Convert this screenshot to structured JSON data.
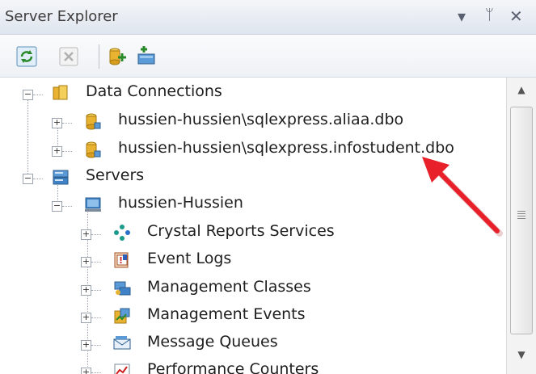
{
  "window": {
    "title": "Server Explorer"
  },
  "title_controls": {
    "dropdown": "▾",
    "pin": "ᛘ",
    "close": "✕"
  },
  "tree": {
    "data_connections": {
      "label": "Data Connections",
      "items": [
        {
          "label": "hussien-hussien\\sqlexpress.aliaa.dbo"
        },
        {
          "label": "hussien-hussien\\sqlexpress.infostudent.dbo"
        }
      ]
    },
    "servers": {
      "label": "Servers",
      "machine": {
        "label": "hussien-Hussien",
        "items": [
          {
            "label": "Crystal Reports Services",
            "icon": "crystal-reports-icon"
          },
          {
            "label": "Event Logs",
            "icon": "event-logs-icon"
          },
          {
            "label": "Management Classes",
            "icon": "management-classes-icon"
          },
          {
            "label": "Management Events",
            "icon": "management-events-icon"
          },
          {
            "label": "Message Queues",
            "icon": "message-queues-icon"
          },
          {
            "label": "Performance Counters",
            "icon": "performance-counters-icon"
          }
        ]
      }
    }
  },
  "colors": {
    "accent_arrow": "#e8202a",
    "db_icon": "#e9b230"
  }
}
